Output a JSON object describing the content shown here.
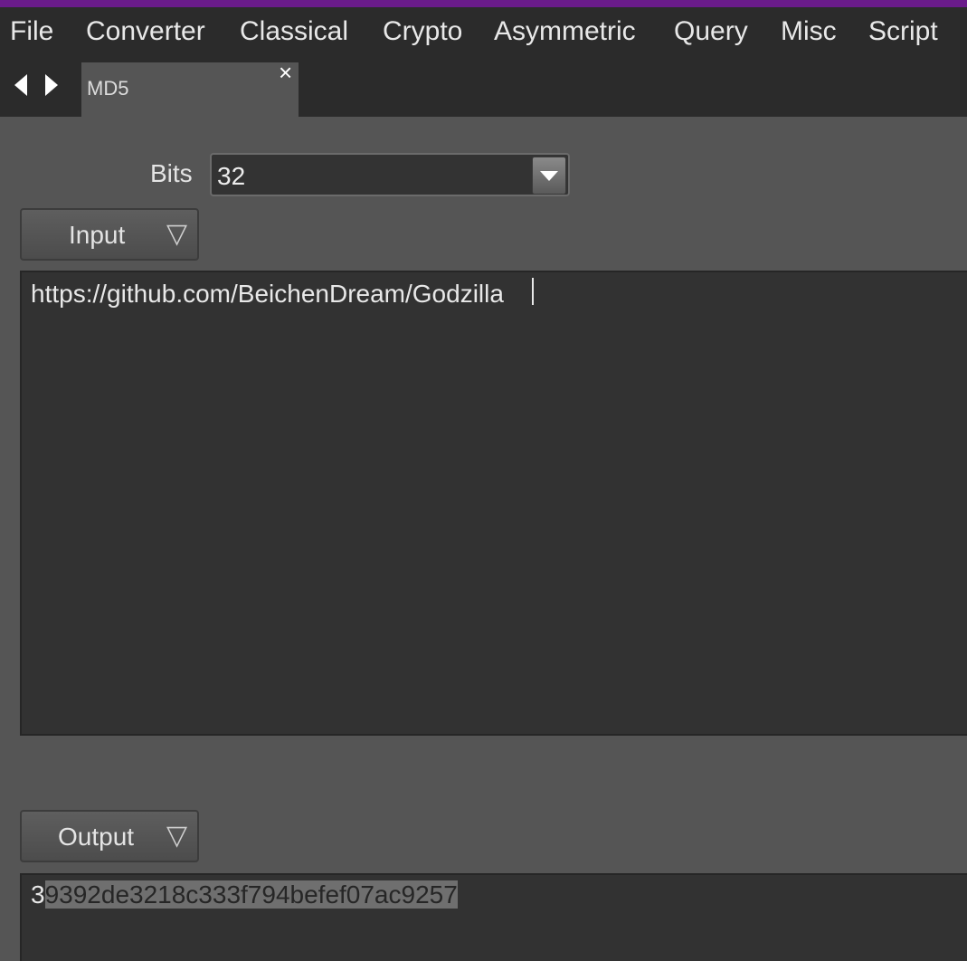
{
  "menu": {
    "items": [
      "File",
      "Converter",
      "Classical",
      "Crypto",
      "Asymmetric",
      "Query",
      "Misc",
      "Script"
    ]
  },
  "tabs": {
    "back_icon": "triangle-left-icon",
    "forward_icon": "triangle-right-icon",
    "active": {
      "label": "MD5",
      "close_glyph": "×"
    }
  },
  "form": {
    "bits_label": "Bits",
    "bits_value": "32"
  },
  "input": {
    "dropdown_label": "Input",
    "dropdown_glyph": "▽",
    "text": "https://github.com/BeichenDream/Godzilla"
  },
  "output": {
    "dropdown_label": "Output",
    "dropdown_glyph": "▽",
    "text_first_char": "3",
    "text_selected": "9392de3218c333f794befef07ac9257"
  },
  "colors": {
    "accent_strip": "#6a1b8a",
    "menubar": "#2b2b2b",
    "panel": "#555555",
    "editor": "#323232"
  }
}
